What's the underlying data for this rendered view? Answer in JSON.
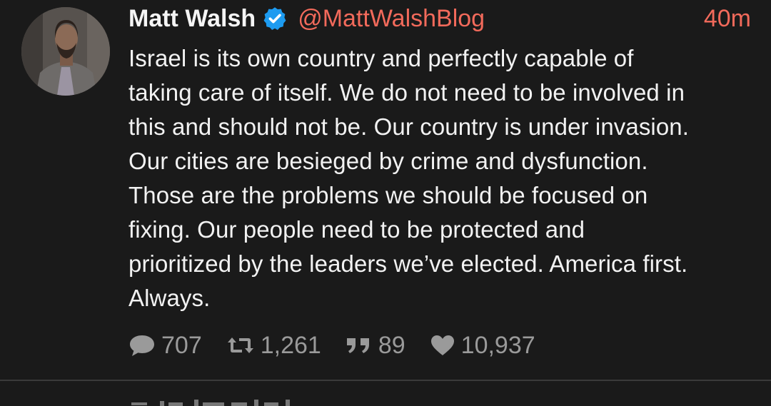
{
  "tweet": {
    "author_name": "Matt Walsh",
    "handle": "@MattWalshBlog",
    "time": "40m",
    "lines": [
      "Israel is its own country and perfectly capable of",
      "taking care of itself. We do not need to be involved in",
      "this and should not be. Our country is under invasion.",
      "Our cities are besieged by crime and dysfunction.",
      "Those are the problems we should be focused on",
      "fixing. Our people need to be protected and",
      "prioritized by the leaders we’ve elected. America first.",
      "Always."
    ],
    "stats": {
      "replies": "707",
      "retweets": "1,261",
      "quotes": "89",
      "likes": "10,937"
    }
  },
  "icons": {
    "verified": "verified-badge-icon",
    "reply": "speech-bubble-icon",
    "retweet": "retweet-icon",
    "quote": "quote-icon",
    "like": "heart-icon"
  },
  "colors": {
    "background": "#1a1a1a",
    "text": "#f2f2f2",
    "accent": "#f26a5b",
    "verified": "#1d9bf0",
    "muted": "#9a9a9a"
  }
}
